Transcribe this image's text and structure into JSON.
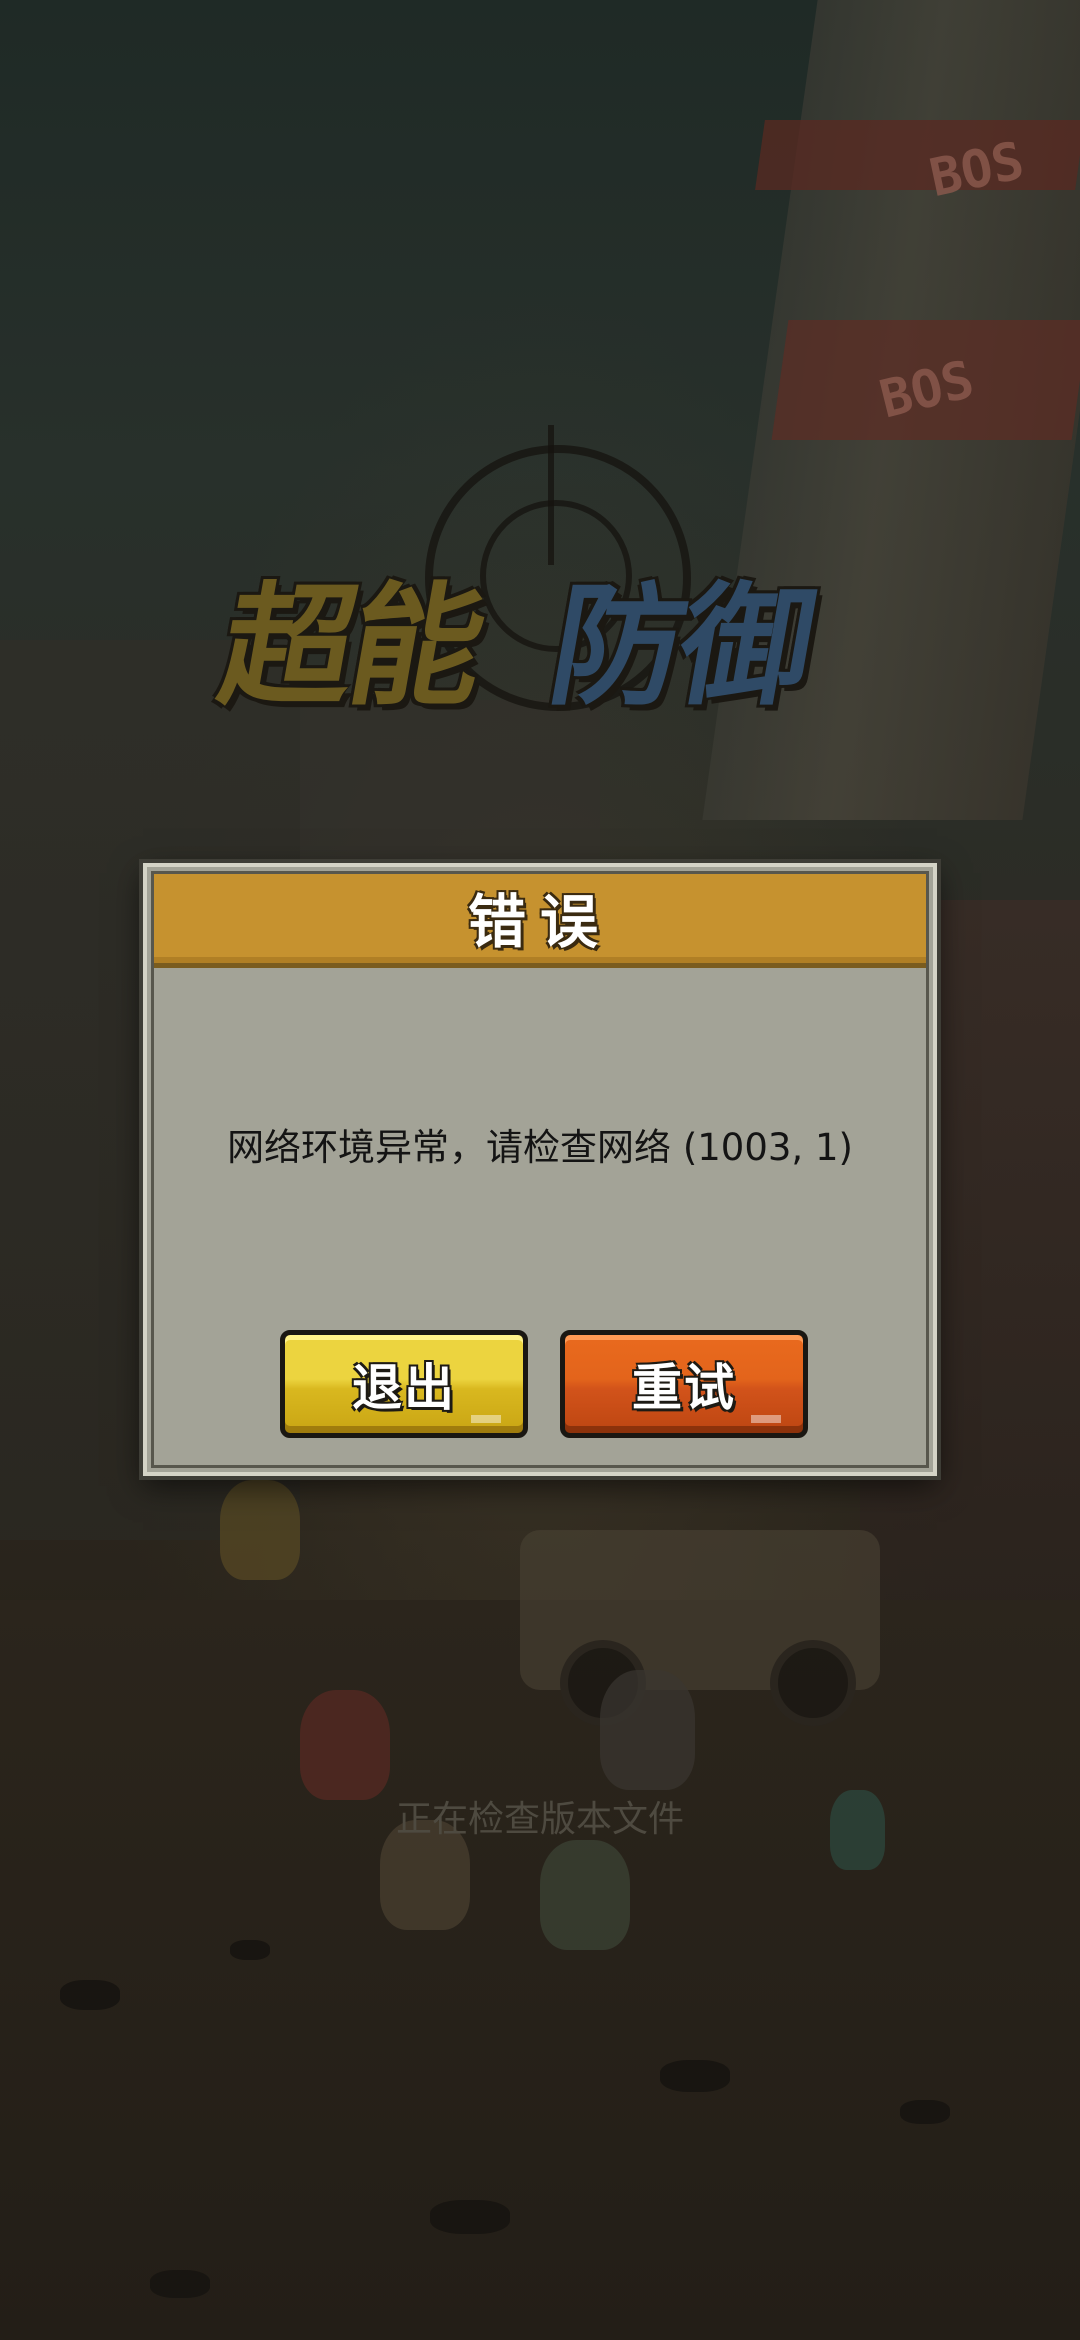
{
  "game": {
    "logo_part1": "超能",
    "logo_part2": "防御",
    "building_sign_top": "BOS",
    "building_sign_mid": "BOS",
    "loading_status": "正在检查版本文件"
  },
  "dialog": {
    "title": "错误",
    "message": "网络环境异常，请检查网络 (1003, 1)",
    "buttons": {
      "exit_label": "退出",
      "retry_label": "重试"
    }
  },
  "colors": {
    "header": "#c6922f",
    "panel": "#a3a397",
    "exit_button": "#ecd43f",
    "retry_button": "#e3641b"
  }
}
